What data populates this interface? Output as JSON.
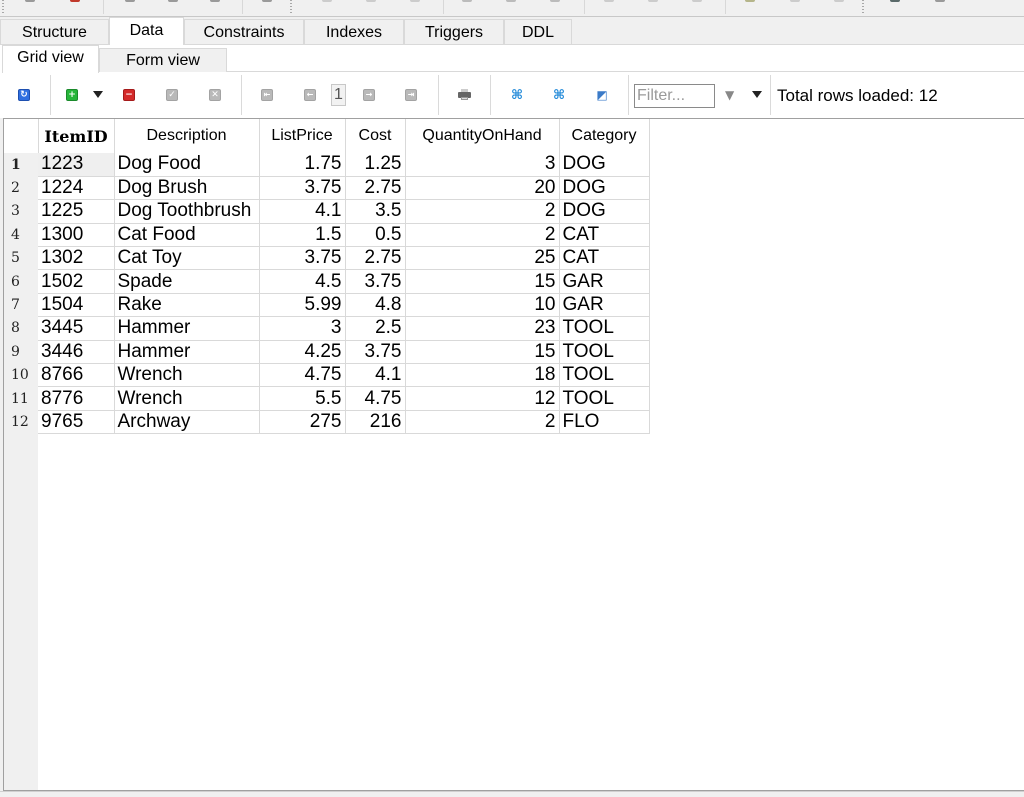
{
  "main_tabs": [
    {
      "label": "Structure",
      "active": false
    },
    {
      "label": "Data",
      "active": true
    },
    {
      "label": "Constraints",
      "active": false
    },
    {
      "label": "Indexes",
      "active": false
    },
    {
      "label": "Triggers",
      "active": false
    },
    {
      "label": "DDL",
      "active": false
    }
  ],
  "sub_tabs": [
    {
      "label": "Grid view",
      "active": true
    },
    {
      "label": "Form view",
      "active": false
    }
  ],
  "toolbar": {
    "icons": {
      "refresh": "refresh-icon",
      "insert_row": "add-row-icon",
      "insert_dropdown": "dropdown-arrow-icon",
      "delete_row": "delete-row-icon",
      "commit": "commit-icon",
      "rollback": "rollback-icon",
      "first_page": "first-page-icon",
      "prev_page": "prev-page-icon",
      "next_page": "next-page-icon",
      "last_page": "last-page-icon",
      "print": "printer-icon",
      "expand": "fit-columns-icon",
      "collapse": "fit-columns-alt-icon",
      "export": "export-icon",
      "filter": "filter-icon",
      "filter_dropdown": "dropdown-arrow-icon"
    },
    "page_number": "1",
    "filter_placeholder": "Filter...",
    "filter_value": "",
    "rows_loaded_text": "Total rows loaded: 12"
  },
  "grid": {
    "columns": [
      "ItemID",
      "Description",
      "ListPrice",
      "Cost",
      "QuantityOnHand",
      "Category"
    ],
    "rows": [
      {
        "n": "1",
        "ItemID": "1223",
        "Description": "Dog Food",
        "ListPrice": "1.75",
        "Cost": "1.25",
        "QuantityOnHand": "3",
        "Category": "DOG"
      },
      {
        "n": "2",
        "ItemID": "1224",
        "Description": "Dog Brush",
        "ListPrice": "3.75",
        "Cost": "2.75",
        "QuantityOnHand": "20",
        "Category": "DOG"
      },
      {
        "n": "3",
        "ItemID": "1225",
        "Description": "Dog Toothbrush",
        "ListPrice": "4.1",
        "Cost": "3.5",
        "QuantityOnHand": "2",
        "Category": "DOG"
      },
      {
        "n": "4",
        "ItemID": "1300",
        "Description": "Cat Food",
        "ListPrice": "1.5",
        "Cost": "0.5",
        "QuantityOnHand": "2",
        "Category": "CAT"
      },
      {
        "n": "5",
        "ItemID": "1302",
        "Description": "Cat Toy",
        "ListPrice": "3.75",
        "Cost": "2.75",
        "QuantityOnHand": "25",
        "Category": "CAT"
      },
      {
        "n": "6",
        "ItemID": "1502",
        "Description": "Spade",
        "ListPrice": "4.5",
        "Cost": "3.75",
        "QuantityOnHand": "15",
        "Category": "GAR"
      },
      {
        "n": "7",
        "ItemID": "1504",
        "Description": "Rake",
        "ListPrice": "5.99",
        "Cost": "4.8",
        "QuantityOnHand": "10",
        "Category": "GAR"
      },
      {
        "n": "8",
        "ItemID": "3445",
        "Description": "Hammer",
        "ListPrice": "3",
        "Cost": "2.5",
        "QuantityOnHand": "23",
        "Category": "TOOL"
      },
      {
        "n": "9",
        "ItemID": "3446",
        "Description": "Hammer",
        "ListPrice": "4.25",
        "Cost": "3.75",
        "QuantityOnHand": "15",
        "Category": "TOOL"
      },
      {
        "n": "10",
        "ItemID": "8766",
        "Description": "Wrench",
        "ListPrice": "4.75",
        "Cost": "4.1",
        "QuantityOnHand": "18",
        "Category": "TOOL"
      },
      {
        "n": "11",
        "ItemID": "8776",
        "Description": "Wrench",
        "ListPrice": "5.5",
        "Cost": "4.75",
        "QuantityOnHand": "12",
        "Category": "TOOL"
      },
      {
        "n": "12",
        "ItemID": "9765",
        "Description": "Archway",
        "ListPrice": "275",
        "Cost": "216",
        "QuantityOnHand": "2",
        "Category": "FLO"
      }
    ]
  },
  "colors": {
    "accent_blue": "#2f6fe0",
    "add_green": "#27b53a",
    "delete_red": "#d42a2a",
    "grid_line": "#d9d9d9"
  }
}
